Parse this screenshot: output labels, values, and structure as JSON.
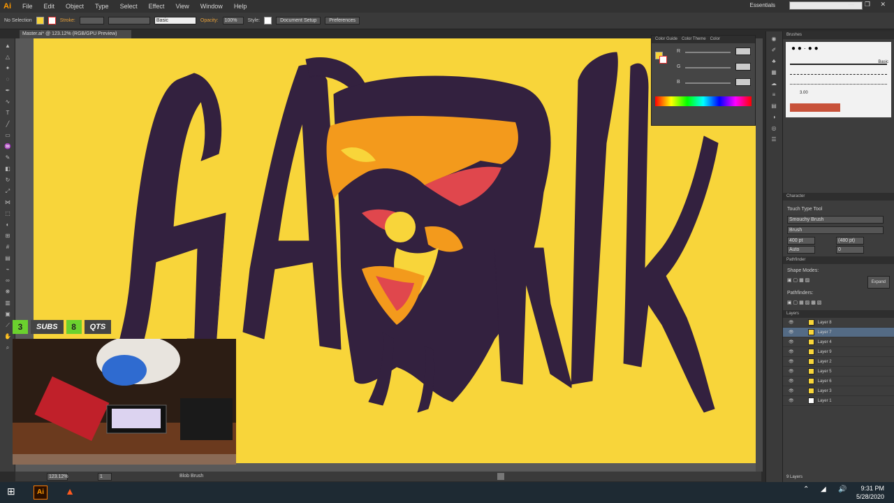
{
  "app": {
    "logo": "Ai",
    "menu": [
      "File",
      "Edit",
      "Object",
      "Type",
      "Select",
      "Effect",
      "View",
      "Window",
      "Help"
    ],
    "workspace": "Essentials",
    "window_controls": "— ❐ ✕"
  },
  "control_bar": {
    "selection": "No Selection",
    "stroke_label": "Stroke:",
    "brush": "Basic",
    "opacity_label": "Opacity:",
    "opacity": "100%",
    "style_label": "Style:",
    "doc_setup": "Document Setup",
    "preferences": "Preferences"
  },
  "document": {
    "tab": "Master.ai* @ 123.12% (RGB/GPU Preview)",
    "zoom": "123.12%",
    "page": "1",
    "status_tool": "Blob Brush"
  },
  "color_panel": {
    "tabs": [
      "Color Guide",
      "Color Theme",
      "Color"
    ],
    "channels": [
      "R",
      "G",
      "B"
    ]
  },
  "brushes_panel": {
    "title": "Brushes",
    "basic_label": "Basic",
    "size": "3.00"
  },
  "character_panel": {
    "title": "Character",
    "touch_tool": "Touch Type Tool",
    "font": "Smouchy Brush",
    "style": "Brush",
    "size": "400 pt",
    "leading": "(480 pt)",
    "kerning": "Auto",
    "tracking": "0"
  },
  "pathfinder_panel": {
    "title": "Pathfinder",
    "shape_modes": "Shape Modes:",
    "pathfinders": "Pathfinders:",
    "expand": "Expand"
  },
  "layers_panel": {
    "title": "Layers",
    "layers": [
      "Layer 8",
      "Layer 7",
      "Layer 4",
      "Layer 9",
      "Layer 2",
      "Layer 5",
      "Layer 6",
      "Layer 3",
      "Layer 1"
    ],
    "selected": "Layer 7",
    "count": "9 Layers"
  },
  "overlay": {
    "subs_count": "3",
    "subs_label": "SUBS",
    "qts_count": "8",
    "qts_label": "QTS"
  },
  "taskbar": {
    "time": "9:31 PM",
    "date": "5/28/2020"
  },
  "colors": {
    "artboard": "#f8d53a",
    "ink": "#33213f",
    "orange": "#f39a1c",
    "red": "#e0474d",
    "accent": "#6bd12e"
  }
}
